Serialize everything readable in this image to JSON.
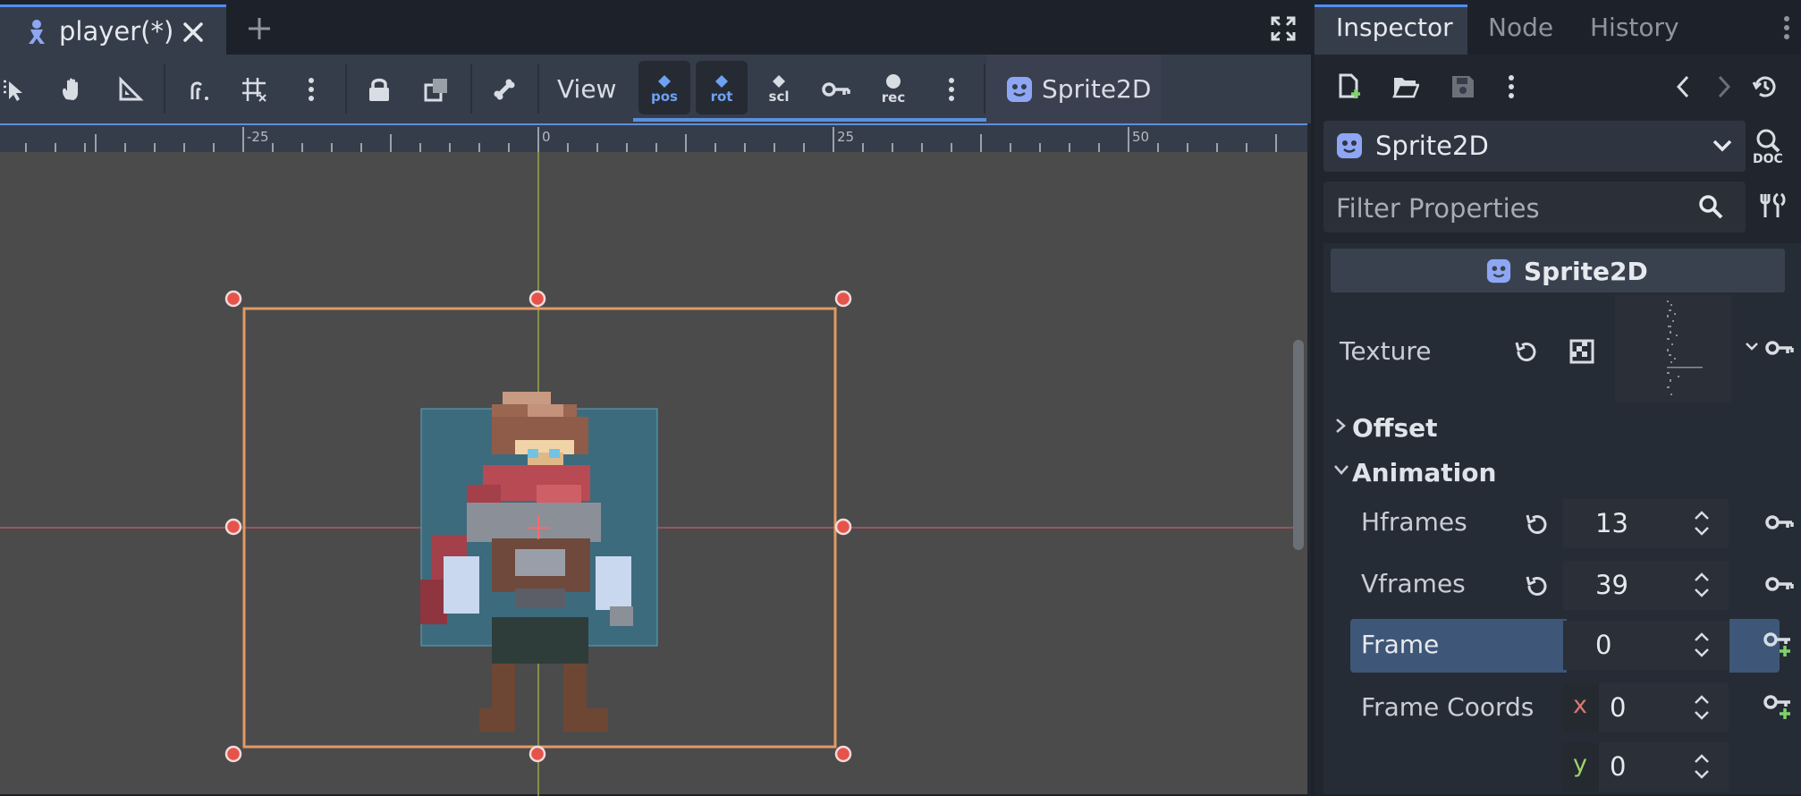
{
  "editor": {
    "tab_title": "player(*)",
    "toolbar": {
      "view_label": "View",
      "pos_label": "pos",
      "rot_label": "rot",
      "scl_label": "scl",
      "rec_label": "rec",
      "node_label": "Sprite2D"
    },
    "ruler": {
      "ticks": [
        "-25",
        "0",
        "25",
        "50"
      ]
    }
  },
  "inspector": {
    "tabs": [
      "Inspector",
      "Node",
      "History"
    ],
    "active_tab": "Inspector",
    "selected_node": "Sprite2D",
    "filter_placeholder": "Filter Properties",
    "category": "Sprite2D",
    "texture_label": "Texture",
    "sections": {
      "offset": "Offset",
      "animation": "Animation"
    },
    "properties": {
      "hframes": {
        "label": "Hframes",
        "value": "13"
      },
      "vframes": {
        "label": "Vframes",
        "value": "39"
      },
      "frame": {
        "label": "Frame",
        "value": "0"
      },
      "frame_coords": {
        "label": "Frame Coords",
        "x_label": "x",
        "x": "0",
        "y_label": "y",
        "y": "0"
      }
    }
  },
  "colors": {
    "accent": "#4f8df0",
    "selection_box": "#e29a63",
    "handle": "#e5534b",
    "sprite_bg": "#3d6b7e",
    "viewport_bg": "#4b4b4b",
    "godot_icon": "#8ea6f4"
  }
}
